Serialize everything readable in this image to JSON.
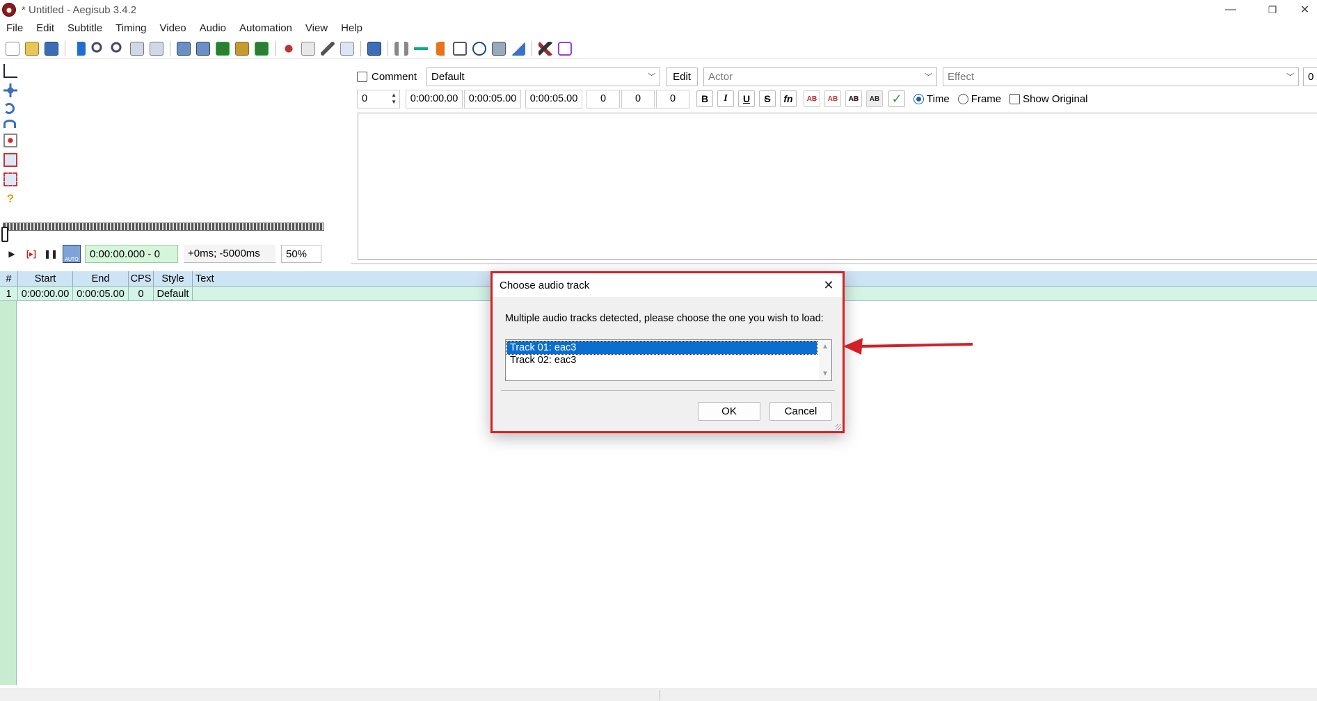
{
  "window": {
    "title": "* Untitled - Aegisub 3.4.2",
    "minimize": "—",
    "restore": "❐",
    "close": "✕"
  },
  "menu": [
    "File",
    "Edit",
    "Subtitle",
    "Timing",
    "Video",
    "Audio",
    "Automation",
    "View",
    "Help"
  ],
  "video": {
    "time_display": "0:00:00.000 - 0",
    "offset_display": "+0ms; -5000ms",
    "zoom": "50%",
    "auto_label": "AUTO"
  },
  "editbox": {
    "comment_label": "Comment",
    "style": "Default",
    "edit_button": "Edit",
    "actor_placeholder": "Actor",
    "effect_placeholder": "Effect",
    "layer_right": "0",
    "layer": "0",
    "start_time": "0:00:00.00",
    "end_time": "0:00:05.00",
    "duration": "0:00:05.00",
    "margin_l": "0",
    "margin_r": "0",
    "margin_v": "0",
    "bold": "B",
    "italic": "I",
    "underline": "U",
    "strike": "S",
    "font": "fn",
    "ab": "AB",
    "commit": "✓",
    "time_label": "Time",
    "frame_label": "Frame",
    "show_original_label": "Show Original"
  },
  "grid": {
    "headers": [
      "#",
      "Start",
      "End",
      "CPS",
      "Style",
      "Text"
    ],
    "rows": [
      {
        "num": "1",
        "start": "0:00:00.00",
        "end": "0:00:05.00",
        "cps": "0",
        "style": "Default",
        "text": ""
      }
    ]
  },
  "dialog": {
    "title": "Choose audio track",
    "close": "✕",
    "message": "Multiple audio tracks detected, please choose the one you wish to load:",
    "tracks": [
      "Track 01: eac3",
      "Track 02: eac3"
    ],
    "ok": "OK",
    "cancel": "Cancel"
  },
  "colors": {
    "highlight_border": "#d32027",
    "arrow": "#d32027",
    "selection": "#0a6ed1"
  }
}
